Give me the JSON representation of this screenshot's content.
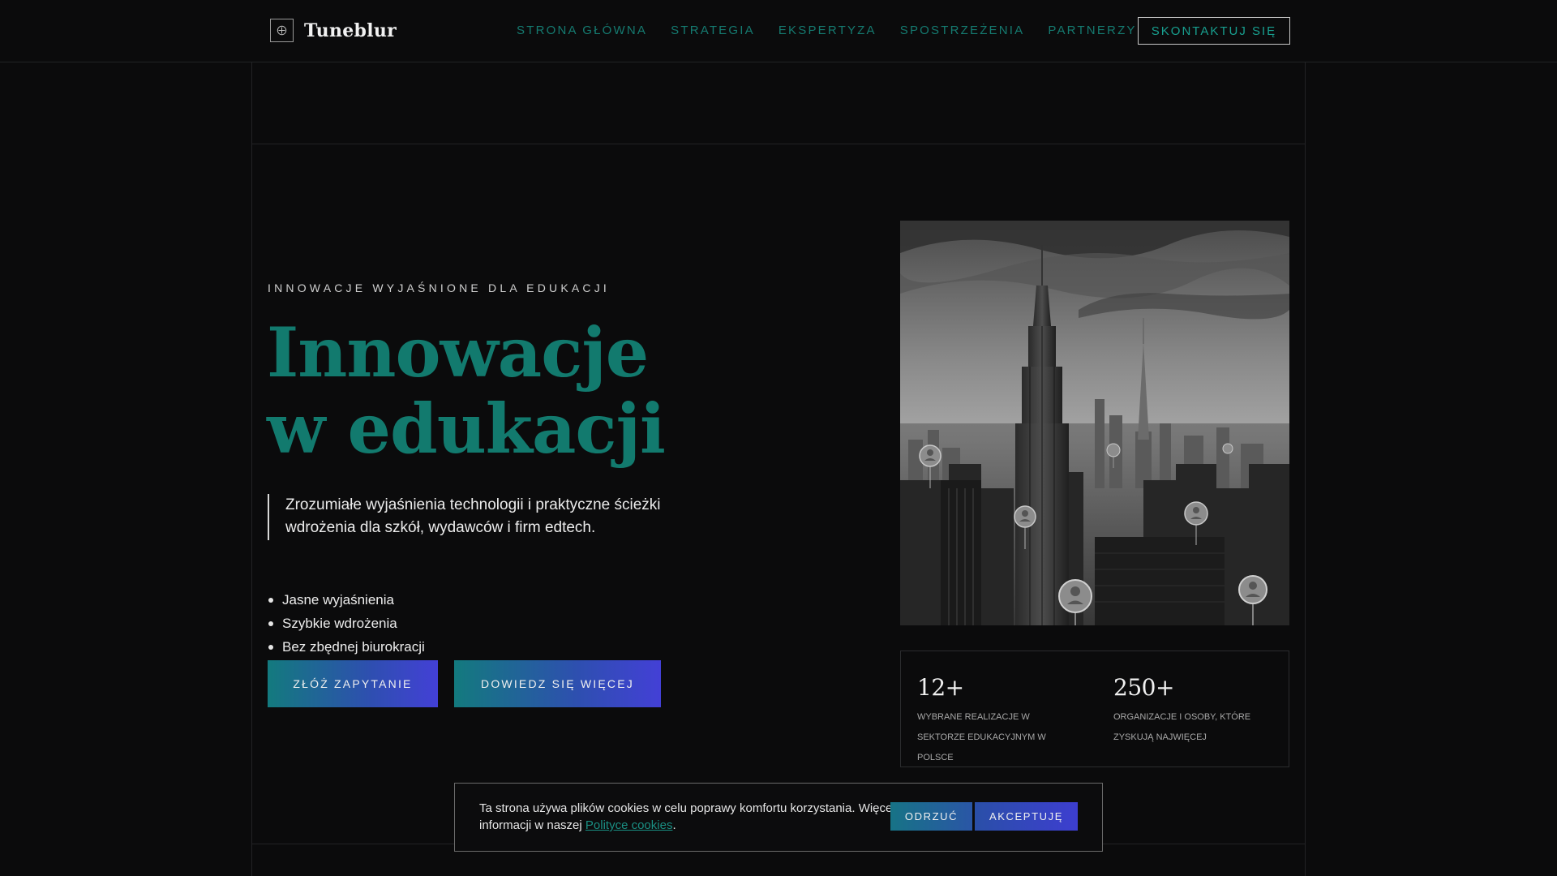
{
  "header": {
    "logo_text": "Tuneblur",
    "nav": [
      "STRONA GŁÓWNA",
      "STRATEGIA",
      "EKSPERTYZA",
      "SPOSTRZEŻENIA",
      "PARTNERZY"
    ],
    "contact_label": "SKONTAKTUJ SIĘ"
  },
  "hero": {
    "eyebrow": "INNOWACJE WYJAŚNIONE DLA EDUKACJI",
    "title": "Innowacje w edukacji",
    "lead": "Zrozumiałe wyjaśnienia technologii i praktyczne ścieżki wdrożenia dla szkół, wydawców i firm edtech.",
    "bullets": [
      "Jasne wyjaśnienia",
      "Szybkie wdrożenia",
      "Bez zbędnej biurokracji"
    ],
    "cta_primary": "ZŁÓŻ ZAPYTANIE",
    "cta_secondary": "DOWIEDZ SIĘ WIĘCEJ"
  },
  "stats": [
    {
      "value": "12+",
      "label": "WYBRANE REALIZACJE W SEKTORZE EDUKACYJNYM W POLSCE"
    },
    {
      "value": "250+",
      "label": "ORGANIZACJE I OSOBY, KTÓRE ZYSKUJĄ NAJWIĘCEJ"
    }
  ],
  "cookie": {
    "text_before": "Ta strona używa plików cookies w celu poprawy komfortu korzystania. Więcej informacji w naszej ",
    "link": "Polityce cookies",
    "text_after": ".",
    "reject": "ODRZUĆ",
    "accept": "AKCEPTUJĘ"
  },
  "colors": {
    "accent_teal": "#127a6e",
    "gradient_start": "#137a7e",
    "gradient_end": "#4340d6",
    "background": "#0b0b0c"
  }
}
